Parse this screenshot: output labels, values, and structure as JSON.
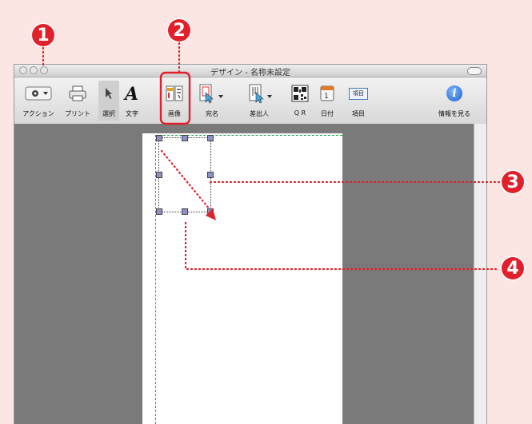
{
  "window": {
    "title": "デザイン - 名称未設定"
  },
  "toolbar": {
    "items": [
      {
        "label": "アクション",
        "icon": "gear-icon"
      },
      {
        "label": "プリント",
        "icon": "printer-icon"
      },
      {
        "label": "選択",
        "icon": "arrow-pointer-icon"
      },
      {
        "label": "文字",
        "icon": "text-a-icon"
      },
      {
        "label": "画像",
        "icon": "image-icon"
      },
      {
        "label": "宛名",
        "icon": "address-icon"
      },
      {
        "label": "差出人",
        "icon": "sender-icon"
      },
      {
        "label": "Q R",
        "icon": "qr-code-icon"
      },
      {
        "label": "日付",
        "icon": "calendar-icon"
      },
      {
        "label": "項目",
        "icon": "field-icon",
        "icon_text": "項目"
      },
      {
        "label": "情報を見る",
        "icon": "info-icon",
        "icon_text": "i"
      }
    ]
  },
  "callouts": [
    "1",
    "2",
    "3",
    "4"
  ],
  "colors": {
    "callout": "#e0202a",
    "background": "#fce6e3",
    "canvas": "#7a7a7a",
    "margin_guide": "#1fa84a"
  }
}
